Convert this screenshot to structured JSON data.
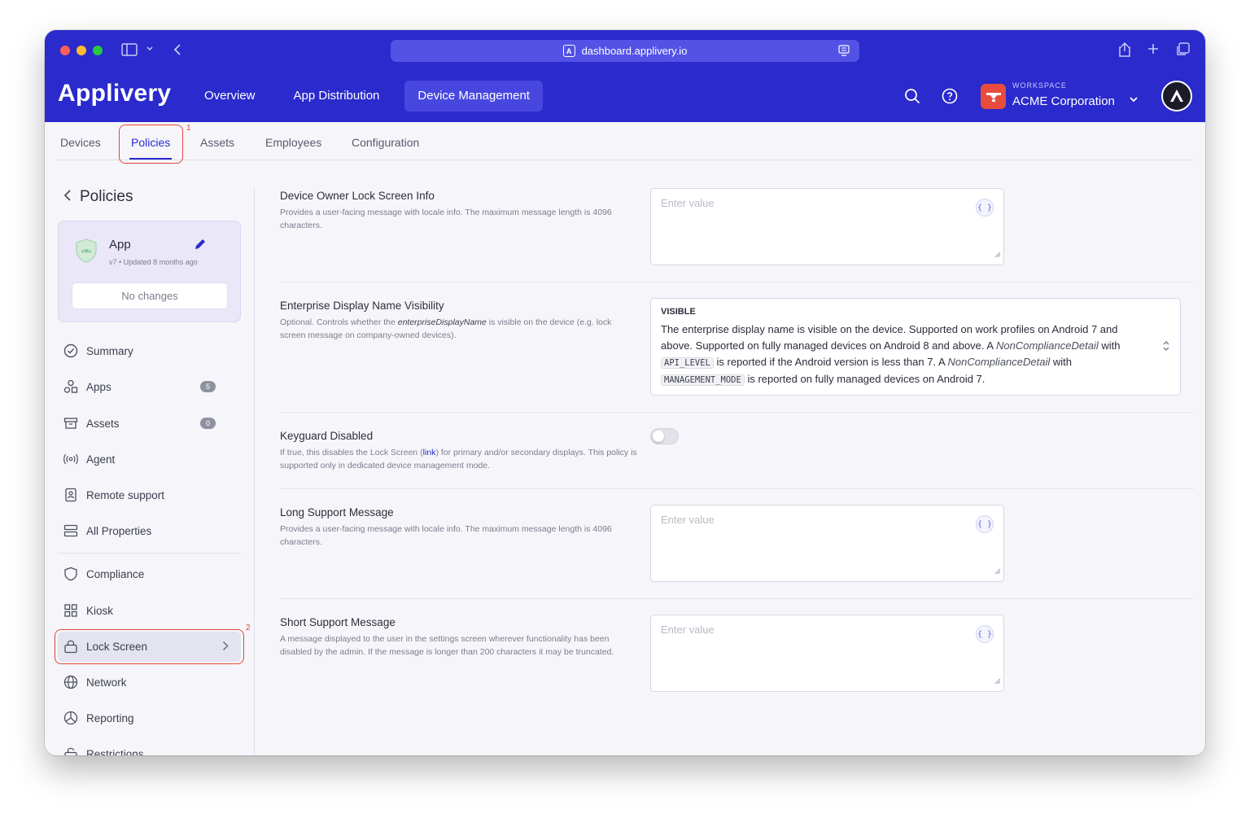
{
  "browser": {
    "url": "dashboard.applivery.io"
  },
  "header": {
    "logo": "Applivery",
    "nav": [
      "Overview",
      "App Distribution",
      "Device Management"
    ],
    "workspace_label": "WORKSPACE",
    "workspace_name": "ACME Corporation"
  },
  "subnav": {
    "tabs": [
      "Devices",
      "Policies",
      "Assets",
      "Employees",
      "Configuration"
    ],
    "active": "Policies"
  },
  "annotations": {
    "first": "1",
    "second": "2"
  },
  "sidebar": {
    "title": "Policies",
    "app": {
      "name": "App",
      "meta": "v7 • Updated 8 months ago",
      "status": "No changes"
    },
    "items": [
      {
        "label": "Summary",
        "icon": "check-circle-icon"
      },
      {
        "label": "Apps",
        "icon": "apps-icon",
        "count": "5"
      },
      {
        "label": "Assets",
        "icon": "assets-icon",
        "count": "0"
      },
      {
        "label": "Agent",
        "icon": "broadcast-icon"
      },
      {
        "label": "Remote support",
        "icon": "remote-icon"
      },
      {
        "label": "All Properties",
        "icon": "list-icon"
      },
      {
        "label": "Compliance",
        "icon": "shield-icon"
      },
      {
        "label": "Kiosk",
        "icon": "grid-icon"
      },
      {
        "label": "Lock Screen",
        "icon": "lock-icon"
      },
      {
        "label": "Network",
        "icon": "globe-icon"
      },
      {
        "label": "Reporting",
        "icon": "chart-icon"
      },
      {
        "label": "Restrictions",
        "icon": "restrictions-icon"
      }
    ]
  },
  "properties": {
    "device_owner": {
      "title": "Device Owner Lock Screen Info",
      "desc": "Provides a user-facing message with locale info. The maximum message length is 4096 characters.",
      "placeholder": "Enter value"
    },
    "enterprise": {
      "title": "Enterprise Display Name Visibility",
      "desc_pre": "Optional. Controls whether the ",
      "desc_italic": "enterpriseDisplayName",
      "desc_post": " is visible on the device (e.g. lock screen message on company-owned devices).",
      "option_title": "VISIBLE",
      "option_1": "The enterprise display name is visible on the device. Supported on work profiles on Android 7 and above. Supported on fully managed devices on Android 8 and above. A ",
      "option_italic_1": "NonComplianceDetail",
      "option_2": " with ",
      "option_code_1": "API_LEVEL",
      "option_3": " is reported if the Android version is less than 7. A ",
      "option_italic_2": "NonComplianceDetail",
      "option_4": " with ",
      "option_code_2": "MANAGEMENT_MODE",
      "option_5": " is reported on fully managed devices on Android 7."
    },
    "keyguard": {
      "title": "Keyguard Disabled",
      "desc_pre": "If true, this disables the Lock Screen (",
      "desc_link": "link",
      "desc_post": ") for primary and/or secondary displays. This policy is supported only in dedicated device management mode.",
      "enabled": false
    },
    "long_support": {
      "title": "Long Support Message",
      "desc": "Provides a user-facing message with locale info. The maximum message length is 4096 characters.",
      "placeholder": "Enter value"
    },
    "short_support": {
      "title": "Short Support Message",
      "desc": "A message displayed to the user in the settings screen wherever functionality has been disabled by the admin. If the message is longer than 200 characters it may be truncated.",
      "placeholder": "Enter value"
    },
    "brace_glyph": "{ }"
  }
}
